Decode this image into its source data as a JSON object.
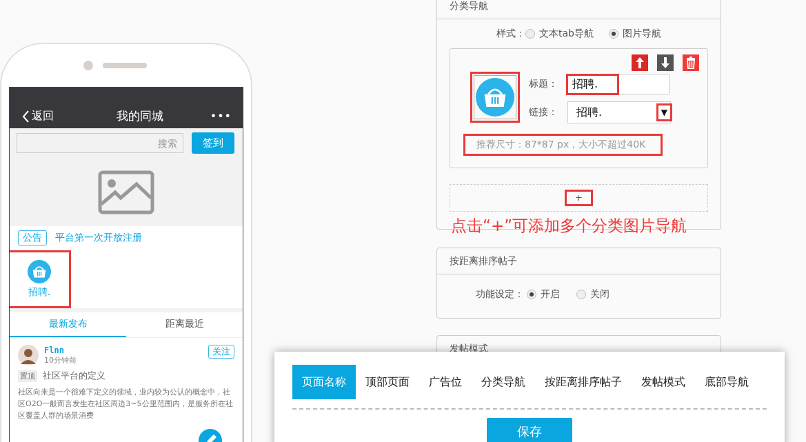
{
  "phone": {
    "header": {
      "back": "返回",
      "title": "我的同城",
      "more": "•••"
    },
    "search": {
      "placeholder": "搜索"
    },
    "checkin_button": "签到",
    "notice": {
      "tag": "公告",
      "text": "平台第一次开放注册"
    },
    "category_nav": [
      {
        "label": "招聘.",
        "highlighted": true
      }
    ],
    "tabs": [
      {
        "label": "最新发布",
        "selected": true
      },
      {
        "label": "距离最近",
        "selected": false
      }
    ],
    "post": {
      "user": "Flnn",
      "time": "10分钟前",
      "follow": "关注",
      "pin_tag": "置顶",
      "title": "社区平台的定义",
      "body": "社区向来是一个很难下定义的领域，业内较为公认的概念中，社区O2O一般而言发生在社区周边3~5公里范围内，是服务所在社区覆盖人群的场景消费"
    }
  },
  "category_panel": {
    "title": "分类导航",
    "style_label": "样式：",
    "style_options": [
      {
        "label": "文本tab导航",
        "selected": false
      },
      {
        "label": "图片导航",
        "selected": true
      }
    ],
    "item": {
      "image_highlighted": true,
      "title_label": "标题：",
      "title_value": "招聘.",
      "title_highlighted": true,
      "link_label": "链接：",
      "link_value": "招聘.",
      "dropdown_arrow": "▼",
      "arrow_highlighted": true,
      "hint": "推荐尺寸：87*87 px，大小不超过40K",
      "hint_highlighted": true
    },
    "add_button": "+",
    "add_highlighted": true,
    "annotation": "点击“+”可添加多个分类图片导航"
  },
  "distance_panel": {
    "title": "按距离排序帖子",
    "label": "功能设定：",
    "options": [
      {
        "label": "开启",
        "selected": true
      },
      {
        "label": "关闭",
        "selected": false
      }
    ]
  },
  "post_mode_panel": {
    "title": "发帖模式"
  },
  "bottom_bar": {
    "tabs": [
      {
        "label": "页面名称",
        "selected": true
      },
      {
        "label": "顶部页面",
        "selected": false
      },
      {
        "label": "广告位",
        "selected": false
      },
      {
        "label": "分类导航",
        "selected": false
      },
      {
        "label": "按距离排序帖子",
        "selected": false
      },
      {
        "label": "发帖模式",
        "selected": false
      },
      {
        "label": "底部导航",
        "selected": false
      }
    ],
    "save_button": "保存"
  }
}
